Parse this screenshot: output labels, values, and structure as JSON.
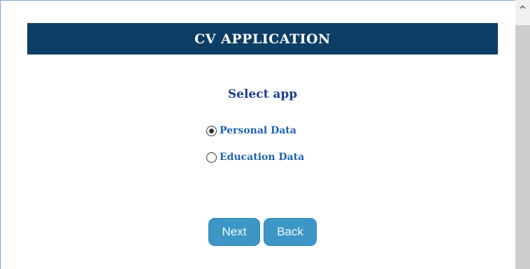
{
  "header": {
    "title": "CV APPLICATION"
  },
  "main": {
    "select_title": "Select app",
    "options": [
      {
        "label": "Personal Data",
        "selected": true
      },
      {
        "label": "Education Data",
        "selected": false
      }
    ]
  },
  "buttons": {
    "next_label": "Next",
    "back_label": "Back"
  },
  "icons": {
    "scroll_up": "chevron-up-icon",
    "radio_selected": "radio-selected-icon",
    "radio_unselected": "radio-unselected-icon"
  },
  "colors": {
    "header_bg": "#0d3e66",
    "title_text": "#1e3f8f",
    "option_text": "#1f63b0",
    "button_bg": "#3c96c6"
  }
}
